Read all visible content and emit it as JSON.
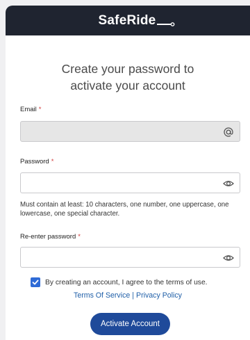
{
  "header": {
    "brand": "SafeRide"
  },
  "main": {
    "heading": "Create your password to activate your account",
    "heading_line1": "Create your password to",
    "heading_line2": "activate your account"
  },
  "form": {
    "email": {
      "label": "Email",
      "required_mark": "*",
      "value": "",
      "icon": "at-icon"
    },
    "password": {
      "label": "Password",
      "required_mark": "*",
      "value": "",
      "icon": "eye-icon"
    },
    "password_hint": "Must contain at least: 10 characters, one number, one uppercase, one lowercase, one special character.",
    "reenter": {
      "label": "Re-enter password",
      "required_mark": "*",
      "value": "",
      "icon": "eye-icon"
    },
    "terms_checkbox": {
      "checked": true,
      "label": "By creating an account, I agree to the terms of use."
    },
    "links": {
      "terms": "Terms Of Service",
      "separator": "|",
      "privacy": "Privacy Policy"
    },
    "submit_label": "Activate Account"
  },
  "colors": {
    "header_bg": "#1f2430",
    "button_bg": "#1f4a9a",
    "link": "#1f5fa8",
    "checkbox": "#2f6bd6",
    "required": "#d23b3b"
  }
}
